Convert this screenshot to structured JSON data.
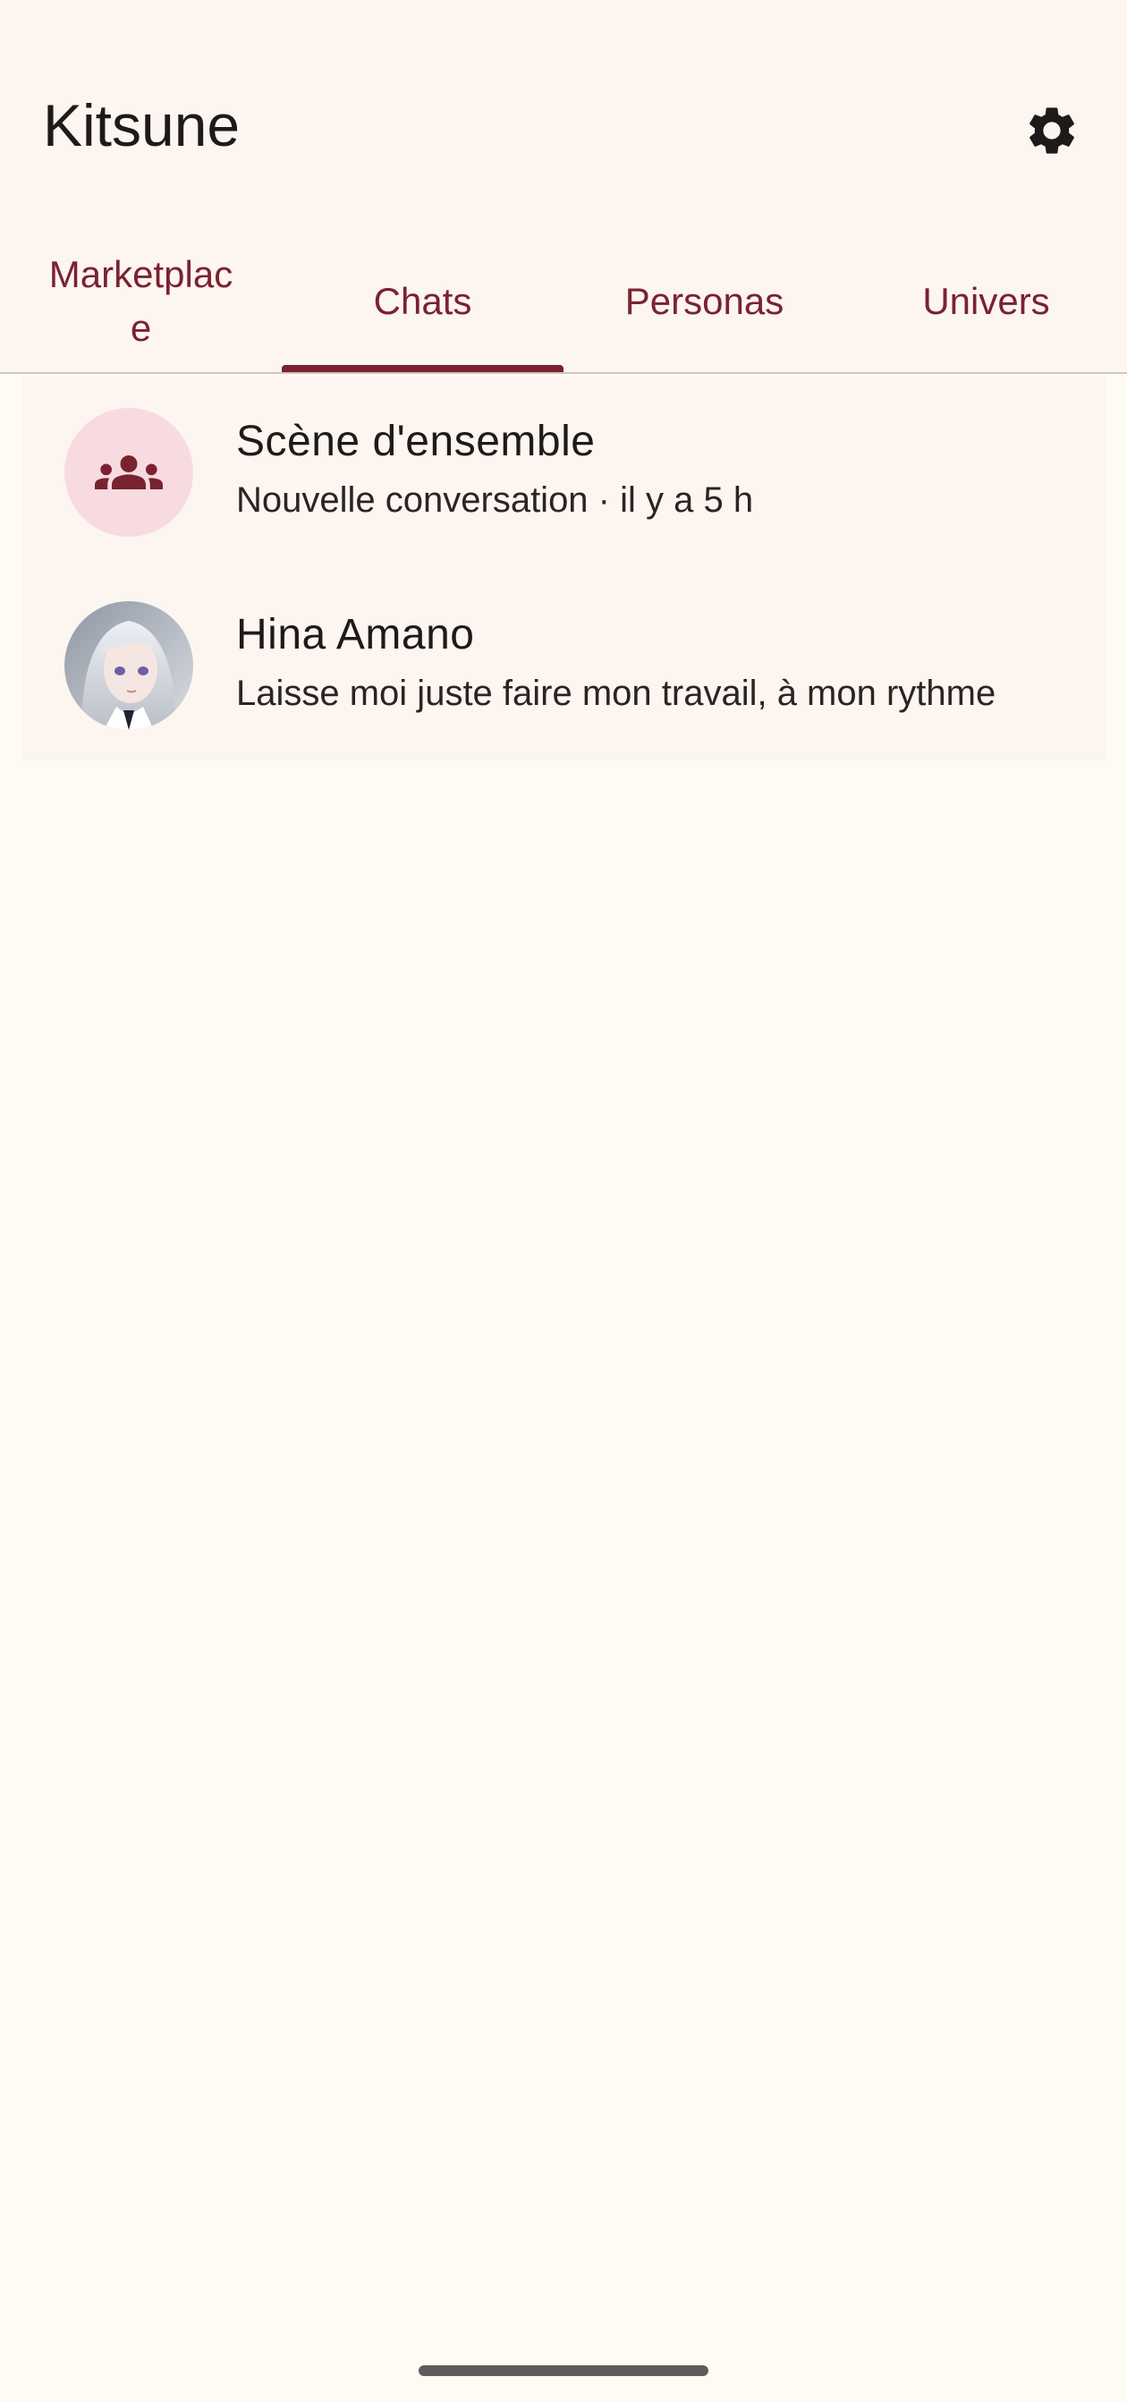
{
  "app": {
    "title": "Kitsune",
    "settings_icon": "gear-icon"
  },
  "colors": {
    "accent": "#7a2230",
    "background": "#fefaf4",
    "surface": "#fdf5f0",
    "group_avatar_bg": "#f7dbe0"
  },
  "tabs": [
    {
      "label": "Marketplace",
      "selected": false
    },
    {
      "label": "Chats",
      "selected": true
    },
    {
      "label": "Personas",
      "selected": false
    },
    {
      "label": "Univers",
      "selected": false
    }
  ],
  "chats": [
    {
      "title": "Scène d'ensemble",
      "subtitle": "Nouvelle conversation · il y a 5 h",
      "avatar": "group-icon"
    },
    {
      "title": "Hina Amano",
      "subtitle": "Laisse moi juste faire mon travail, à mon rythme",
      "avatar": "character-portrait"
    }
  ]
}
